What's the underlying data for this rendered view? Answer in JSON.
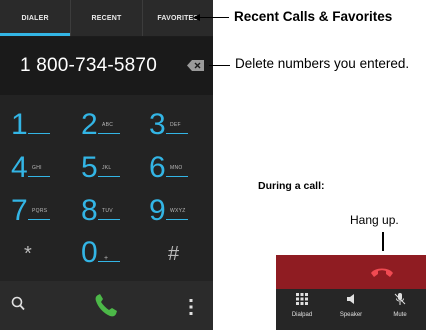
{
  "tabs": [
    {
      "label": "DIALER",
      "active": true
    },
    {
      "label": "RECENT",
      "active": false
    },
    {
      "label": "FAVORITES",
      "active": false
    }
  ],
  "dialed_number": "1 800-734-5870",
  "keypad": [
    {
      "digit": "1",
      "letters": ""
    },
    {
      "digit": "2",
      "letters": "ABC"
    },
    {
      "digit": "3",
      "letters": "DEF"
    },
    {
      "digit": "4",
      "letters": "GHI"
    },
    {
      "digit": "5",
      "letters": "JKL"
    },
    {
      "digit": "6",
      "letters": "MNO"
    },
    {
      "digit": "7",
      "letters": "PQRS"
    },
    {
      "digit": "8",
      "letters": "TUV"
    },
    {
      "digit": "9",
      "letters": "WXYZ"
    },
    {
      "digit": "*",
      "letters": ""
    },
    {
      "digit": "0",
      "letters": "+"
    },
    {
      "digit": "#",
      "letters": ""
    }
  ],
  "callouts": {
    "tabs": "Recent Calls & Favorites",
    "delete": "Delete numbers you entered."
  },
  "in_call": {
    "title": "During a call:",
    "hang_up": "Hang up.",
    "controls": [
      {
        "label": "Dialpad",
        "icon": "dialpad-icon"
      },
      {
        "label": "Speaker",
        "icon": "speaker-icon"
      },
      {
        "label": "Mute",
        "icon": "mute-icon"
      }
    ]
  },
  "colors": {
    "accent": "#33b5e5",
    "call_green": "#4cb848",
    "hangup_red": "#8f1c22",
    "hangup_icon": "#f04a52"
  },
  "icons": [
    "backspace-icon",
    "search-icon",
    "phone-icon",
    "overflow-menu-icon",
    "end-call-icon"
  ]
}
